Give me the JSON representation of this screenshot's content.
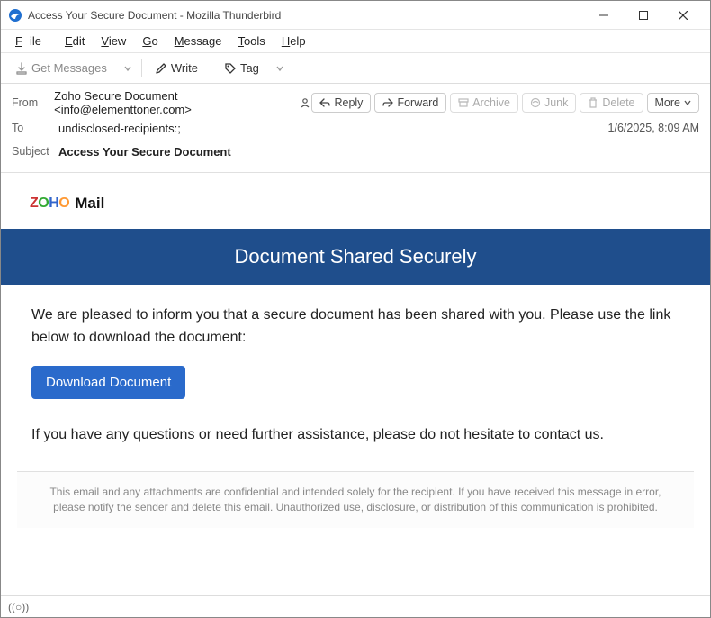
{
  "titlebar": {
    "title": "Access Your Secure Document - Mozilla Thunderbird"
  },
  "menu": {
    "file": "File",
    "edit": "Edit",
    "view": "View",
    "go": "Go",
    "message": "Message",
    "tools": "Tools",
    "help": "Help"
  },
  "toolbar": {
    "get_messages": "Get Messages",
    "write": "Write",
    "tag": "Tag"
  },
  "header": {
    "from_label": "From",
    "from_value": "Zoho Secure Document <info@elementtoner.com>",
    "to_label": "To",
    "to_value": "undisclosed-recipients:;",
    "subject_label": "Subject",
    "subject_value": "Access Your Secure Document",
    "date": "1/6/2025, 8:09 AM"
  },
  "actions": {
    "reply": "Reply",
    "forward": "Forward",
    "archive": "Archive",
    "junk": "Junk",
    "delete": "Delete",
    "more": "More"
  },
  "body": {
    "zoho_mail": "Mail",
    "banner": "Document Shared Securely",
    "p1": "We are pleased to inform you that a secure document has been shared with you. Please use the link below to download the document:",
    "button": "Download Document",
    "p2": "If you have any questions or need further assistance, please do not hesitate to contact us.",
    "disclaimer": "This email and any attachments are confidential and intended solely for the recipient. If you have received this message in error, please notify the sender and delete this email. Unauthorized use, disclosure, or distribution of this communication is prohibited."
  },
  "status": {
    "indicator": "((○))"
  }
}
